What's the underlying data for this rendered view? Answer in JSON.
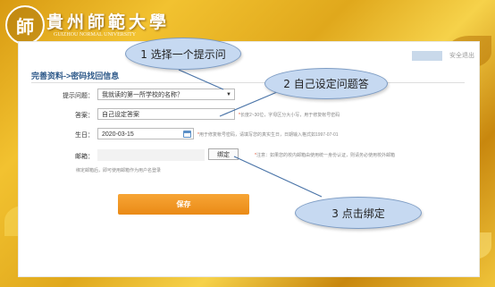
{
  "header": {
    "logo_char": "師",
    "school_name": "貴州師範大學",
    "school_sub": "GUIZHOU NORMAL UNIVERSITY"
  },
  "topbar": {
    "exit_label": "安全退出"
  },
  "form": {
    "title": "完善资料->密码找回信息",
    "question_label": "提示问题：",
    "question_value": "我就读的第一所学校的名称？",
    "answer_label": "答案：",
    "answer_value": "自己设定答案",
    "answer_hint_req": "*",
    "answer_hint": "长度2~30位，字母区分大小写，用于修复帐号密码",
    "birthday_label": "生日：",
    "birthday_value": "2020-03-15",
    "birthday_hint_req": "*",
    "birthday_hint": "用于修复帐号密码，请填写您的真实生日，日期输入格式如1997-07-01",
    "email_label": "邮箱：",
    "email_value": "",
    "bind_label": "绑定",
    "email_hint_req": "*",
    "email_hint": "注意：如果您的校内邮箱由使用统一身份认证，则请务必使用校外邮箱",
    "email_hint2": "绑定邮箱后，即可使用邮箱作为用户名登录",
    "save_label": "保存"
  },
  "callouts": {
    "step1": "1 选择一个提示问",
    "step2": "2 自己设定问题答",
    "step3": "3 点击绑定"
  },
  "colors": {
    "accent": "#ea8a16",
    "title": "#2f5a8a",
    "callout": "#c6d9f1"
  }
}
